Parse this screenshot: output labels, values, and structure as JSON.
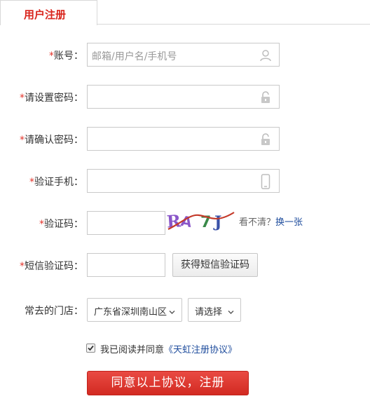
{
  "tab": {
    "title": "用户注册"
  },
  "form": {
    "account": {
      "label": "账号：",
      "placeholder": "邮箱/用户名/手机号"
    },
    "password": {
      "label": "请设置密码："
    },
    "confirm_password": {
      "label": "请确认密码："
    },
    "phone": {
      "label": "验证手机："
    },
    "captcha": {
      "label": "验证码：",
      "image_text": "RA7J",
      "help_text": "看不清？",
      "refresh_link": "换一张"
    },
    "sms": {
      "label": "短信验证码：",
      "button": "获得短信验证码"
    },
    "store": {
      "label": "常去的门店：",
      "region_value": "广东省深圳南山区",
      "store_value": "请选择"
    },
    "required_mark": "*"
  },
  "agreement": {
    "checked": true,
    "text": "我已阅读并同意",
    "link": "《天虹注册协议》"
  },
  "submit": {
    "label": "同意以上协议，注册"
  },
  "colors": {
    "accent": "#d9251d",
    "required": "#e3332a",
    "link": "#1f4d9d",
    "button": "#dd3a33"
  },
  "icons": [
    "user-icon",
    "lock-icon",
    "lock-icon",
    "mobile-phone-icon",
    "chevron-down-icon",
    "checkmark-icon"
  ]
}
